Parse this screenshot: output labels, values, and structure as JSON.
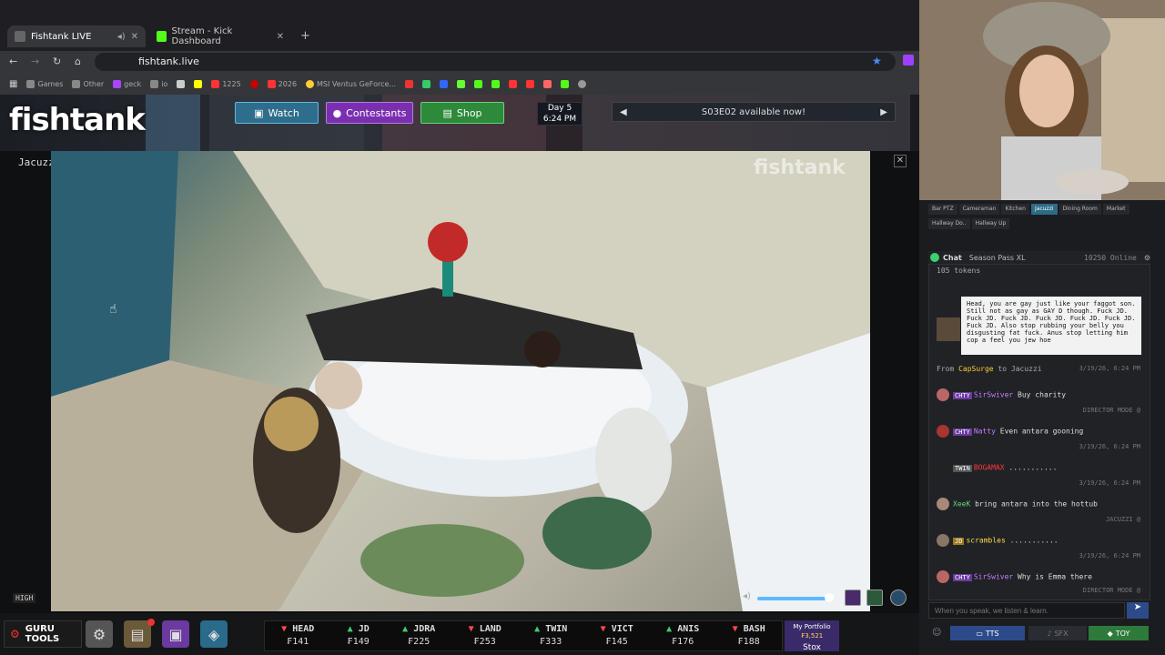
{
  "browser": {
    "tabs": [
      {
        "title": "Fishtank LIVE",
        "active": true
      },
      {
        "title": "Stream - Kick Dashboard",
        "active": false
      }
    ],
    "url": "fishtank.live",
    "bookmarks": [
      "Games",
      "Other",
      "geck",
      "io",
      "1225",
      "2026",
      "MSI Ventus GeForce..."
    ]
  },
  "site": {
    "logo": "fishtank",
    "nav": {
      "watch": "Watch",
      "contestants": "Contestants",
      "shop": "Shop"
    },
    "day": "Day 5",
    "time": "6:24 PM",
    "announcement": "S03E02 available now!",
    "camera_name": "Jacuzzi",
    "quality": "HIGH",
    "watermark": "fishtank"
  },
  "bottom": {
    "guru": "GURU TOOLS",
    "ticker": [
      {
        "name": "HEAD",
        "dir": "down",
        "price": "₣141"
      },
      {
        "name": "JD",
        "dir": "up",
        "price": "₣149"
      },
      {
        "name": "JDRA",
        "dir": "up",
        "price": "₣225"
      },
      {
        "name": "LAND",
        "dir": "down",
        "price": "₣253"
      },
      {
        "name": "TWIN",
        "dir": "up",
        "price": "₣333"
      },
      {
        "name": "VICT",
        "dir": "down",
        "price": "₣145"
      },
      {
        "name": "ANIS",
        "dir": "up",
        "price": "₣176"
      },
      {
        "name": "BASH",
        "dir": "down",
        "price": "₣188"
      }
    ],
    "portfolio_label": "My Portfolio",
    "portfolio_value": "₣3,521",
    "stox": "Stox"
  },
  "panel": {
    "cam_tabs": [
      "Bar PTZ",
      "Cameraman",
      "Kitchen",
      "Jacuzzi",
      "Dining Room",
      "Market",
      "Hallway Do..",
      "Hallway Up"
    ],
    "chat_label": "Chat",
    "season_pass": "Season Pass XL",
    "online": "10250 Online",
    "tokens_line": "105 tokens",
    "tts_text": "Head, you are gay just like your faggot son. Still not as gay as GAY D though. Fuck JD. Fuck JD. Fuck JD. Fuck JD. Fuck JD. Fuck JD. Fuck JD. Also stop rubbing your belly you disgusting fat fuck. Anus stop letting him cop a feel you jew hoe",
    "tts_from": "From",
    "tts_user": "CapSurge",
    "tts_to": "to Jacuzzi",
    "tts_time": "3/19/26, 6:24 PM",
    "messages": [
      {
        "badge": "CHTY",
        "user": "SirSwiver",
        "text": "Buy charity",
        "meta": "DIRECTOR MODE @"
      },
      {
        "badge": "CHTY",
        "user": "Natty",
        "text": "Even antara gooning",
        "meta": "3/19/26, 6:24 PM"
      },
      {
        "badge": "TWIN",
        "user": "BOGAMAX",
        "text": "...........",
        "meta": "3/19/26, 6:24 PM"
      },
      {
        "badge": "",
        "user": "XeeK",
        "text": "bring antara into the hottub",
        "meta": "JACUZZI @"
      },
      {
        "badge": "JD",
        "user": "scrambles",
        "text": "...........",
        "meta": "3/19/26, 6:24 PM"
      },
      {
        "badge": "CHTY",
        "user": "SirSwiver",
        "text": "Why is Emma there",
        "meta": "DIRECTOR MODE @"
      }
    ],
    "input_placeholder": "When you speak, we listen & learn.",
    "buttons": {
      "tts": "TTS",
      "sfx": "SFX",
      "toy": "TOY"
    }
  }
}
